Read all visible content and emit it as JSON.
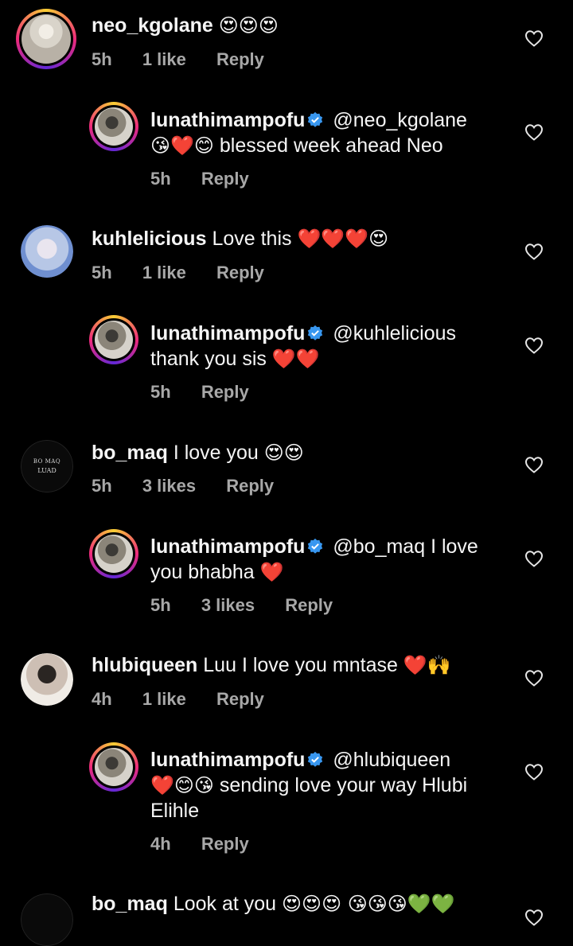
{
  "comments": [
    {
      "username": "neo_kgolane",
      "text": "",
      "emoji": "😍😍😍",
      "time": "5h",
      "likes": "1 like",
      "reply": "Reply",
      "replies": [
        {
          "username": "lunathimampofu",
          "mention": "@neo_kgolane",
          "emoji_before": "😘❤️😊",
          "text": "blessed week ahead Neo",
          "time": "5h",
          "likes": "",
          "reply": "Reply"
        }
      ]
    },
    {
      "username": "kuhlelicious",
      "text": "Love this",
      "emoji": "❤️❤️❤️😍",
      "time": "5h",
      "likes": "1 like",
      "reply": "Reply",
      "replies": [
        {
          "username": "lunathimampofu",
          "mention": "@kuhlelicious",
          "text": "thank you sis",
          "emoji_after": "❤️❤️",
          "time": "5h",
          "likes": "",
          "reply": "Reply"
        }
      ]
    },
    {
      "username": "bo_maq",
      "avatar_text": "BO MAQ",
      "avatar_subtext": "LUAD",
      "text": "I love you",
      "emoji": "😍😍",
      "time": "5h",
      "likes": "3 likes",
      "reply": "Reply",
      "replies": [
        {
          "username": "lunathimampofu",
          "mention": "@bo_maq",
          "text": "I love you bhabha",
          "emoji_after": "❤️",
          "time": "5h",
          "likes": "3 likes",
          "reply": "Reply"
        }
      ]
    },
    {
      "username": "hlubiqueen",
      "text": "Luu I love you mntase",
      "emoji": "❤️🙌",
      "time": "4h",
      "likes": "1 like",
      "reply": "Reply",
      "replies": [
        {
          "username": "lunathimampofu",
          "mention": "@hlubiqueen",
          "emoji_mid": "❤️😊😘",
          "text": "sending love your way Hlubi Elihle",
          "time": "4h",
          "likes": "",
          "reply": "Reply"
        }
      ]
    },
    {
      "username": "bo_maq",
      "text": "Look at you",
      "emoji": "😍😍😍 😘😘😘💚💚",
      "time": "",
      "likes": "",
      "reply": ""
    }
  ],
  "icons": {
    "like": "heart-outline-icon",
    "verified": "verified-badge-icon"
  },
  "colors": {
    "background": "#000000",
    "text": "#f5f5f5",
    "meta": "#a8a8a8",
    "verified": "#3897f0",
    "story_ring": "#ee2a7b"
  }
}
